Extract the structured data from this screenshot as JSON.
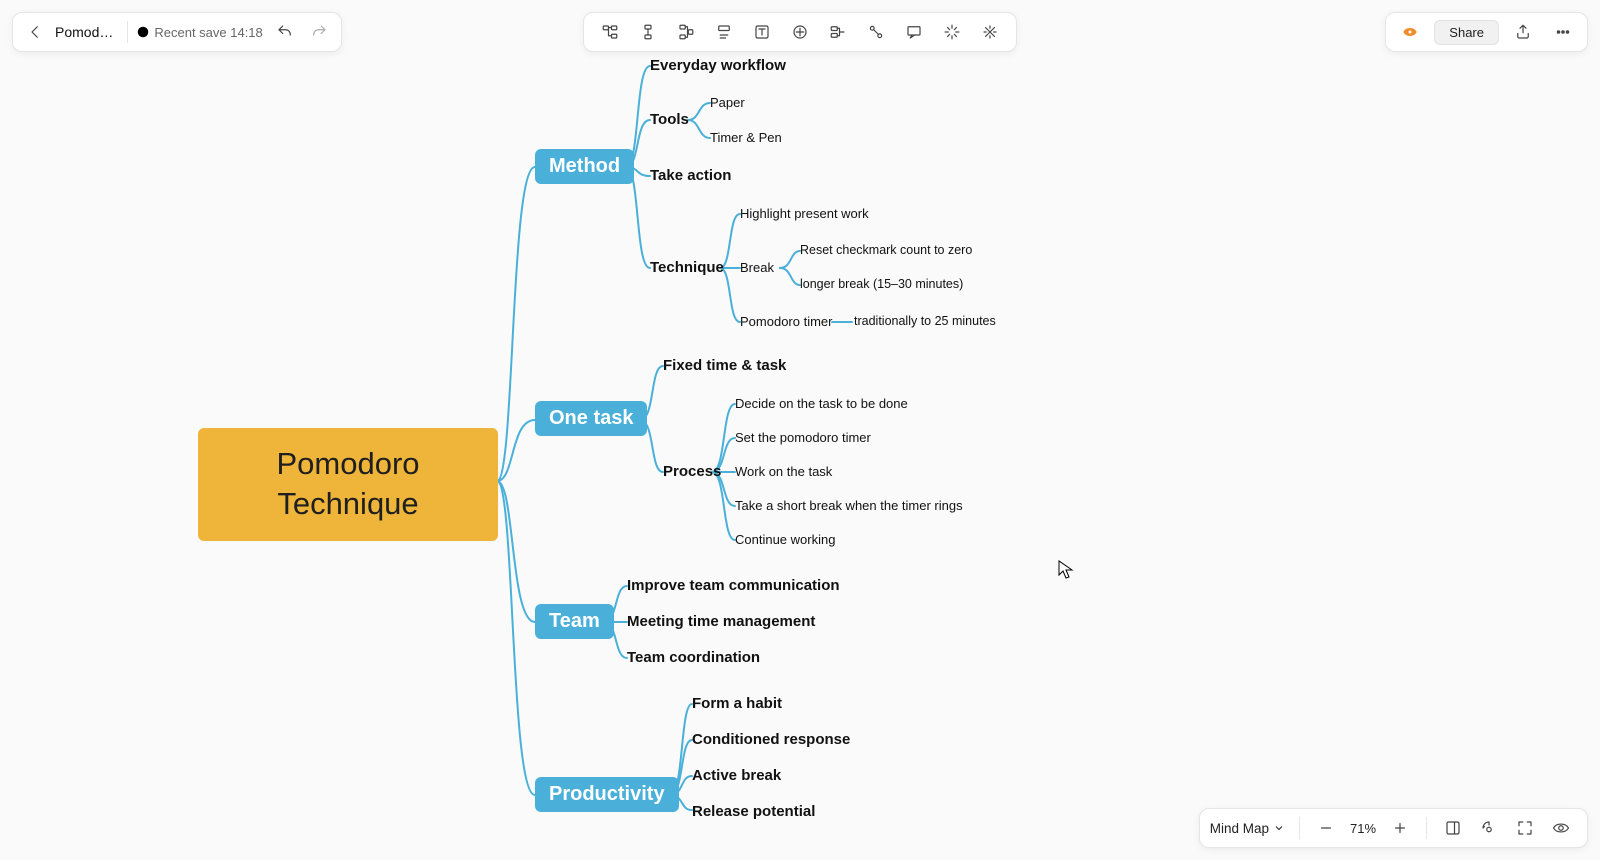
{
  "header": {
    "title": "Pomod…",
    "save_label": "Recent save 14:18"
  },
  "topright": {
    "share_label": "Share"
  },
  "bottom": {
    "mode_label": "Mind Map",
    "zoom": "71%"
  },
  "map": {
    "root": "Pomodoro Technique",
    "method": {
      "label": "Method",
      "everyday": "Everyday workflow",
      "tools": {
        "label": "Tools",
        "paper": "Paper",
        "timerpen": "Timer & Pen"
      },
      "take_action": "Take action",
      "technique": {
        "label": "Technique",
        "highlight": "Highlight present work",
        "break": {
          "label": "Break",
          "reset": "Reset checkmark count to zero",
          "longer": "longer break (15–30 minutes)"
        },
        "timer": {
          "label": "Pomodoro timer",
          "note": "traditionally to 25 minutes"
        }
      }
    },
    "onetask": {
      "label": "One task",
      "fixed": "Fixed time & task",
      "process": {
        "label": "Process",
        "s1": "Decide on the task to be done",
        "s2": "Set the pomodoro timer",
        "s3": "Work on the task",
        "s4": "Take a short break when the timer rings",
        "s5": "Continue working"
      }
    },
    "team": {
      "label": "Team",
      "t1": "Improve team communication",
      "t2": "Meeting time management",
      "t3": "Team coordination"
    },
    "productivity": {
      "label": "Productivity",
      "p1": "Form a habit",
      "p2": "Conditioned response",
      "p3": "Active break",
      "p4": "Release potential"
    }
  }
}
